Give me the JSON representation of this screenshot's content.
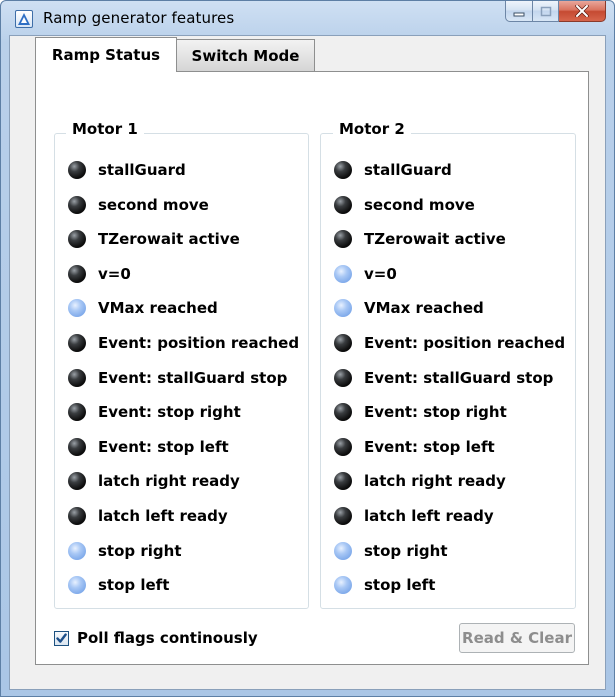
{
  "window": {
    "title": "Ramp generator features"
  },
  "tabs": [
    {
      "label": "Ramp Status",
      "active": true
    },
    {
      "label": "Switch Mode",
      "active": false
    }
  ],
  "motor1": {
    "title": "Motor 1",
    "flags": [
      {
        "label": "stallGuard",
        "on": false
      },
      {
        "label": "second move",
        "on": false
      },
      {
        "label": "TZerowait active",
        "on": false
      },
      {
        "label": "v=0",
        "on": false
      },
      {
        "label": "VMax reached",
        "on": true
      },
      {
        "label": "Event: position reached",
        "on": false
      },
      {
        "label": "Event: stallGuard stop",
        "on": false
      },
      {
        "label": "Event: stop right",
        "on": false
      },
      {
        "label": "Event: stop left",
        "on": false
      },
      {
        "label": "latch right ready",
        "on": false
      },
      {
        "label": "latch left ready",
        "on": false
      },
      {
        "label": "stop right",
        "on": true
      },
      {
        "label": "stop left",
        "on": true
      }
    ]
  },
  "motor2": {
    "title": "Motor 2",
    "flags": [
      {
        "label": "stallGuard",
        "on": false
      },
      {
        "label": "second move",
        "on": false
      },
      {
        "label": "TZerowait active",
        "on": false
      },
      {
        "label": "v=0",
        "on": true
      },
      {
        "label": "VMax reached",
        "on": true
      },
      {
        "label": "Event: position reached",
        "on": false
      },
      {
        "label": "Event: stallGuard stop",
        "on": false
      },
      {
        "label": "Event: stop right",
        "on": false
      },
      {
        "label": "Event: stop left",
        "on": false
      },
      {
        "label": "latch right ready",
        "on": false
      },
      {
        "label": "latch left ready",
        "on": false
      },
      {
        "label": "stop right",
        "on": true
      },
      {
        "label": "stop left",
        "on": true
      }
    ]
  },
  "footer": {
    "poll_label": "Poll flags continously",
    "poll_checked": true,
    "read_clear_label": "Read & Clear",
    "read_clear_enabled": false
  },
  "colors": {
    "led_on": "#7ea9ea",
    "led_off": "#0c0c0c"
  },
  "icons": {
    "app": "app-logo-icon",
    "minimize": "minimize-icon",
    "maximize": "maximize-icon",
    "close": "close-icon",
    "check": "checkmark-icon"
  }
}
